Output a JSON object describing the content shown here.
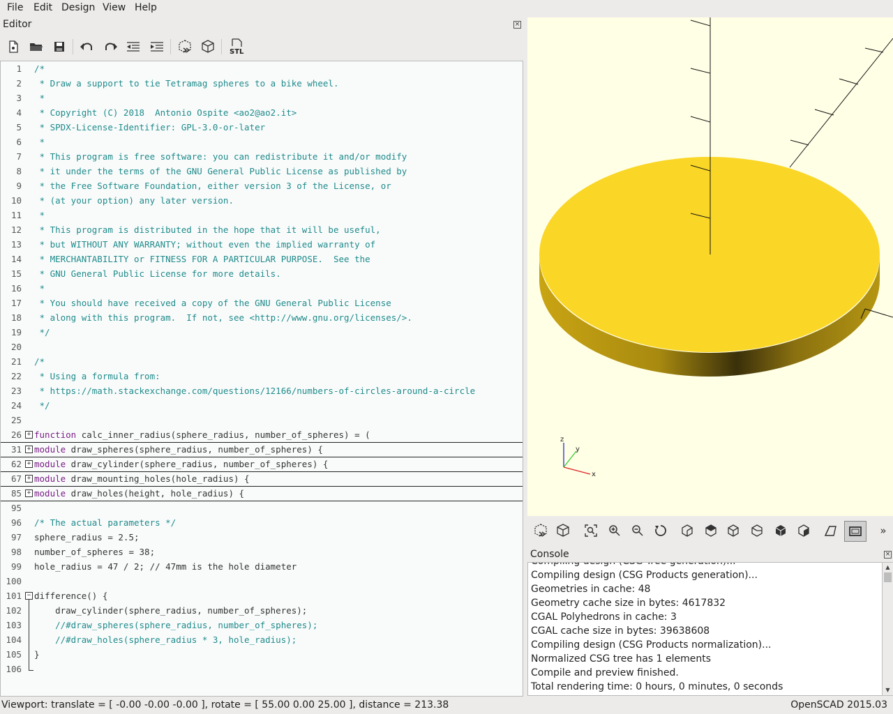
{
  "menu": [
    "File",
    "Edit",
    "Design",
    "View",
    "Help"
  ],
  "editor": {
    "title": "Editor",
    "toolbar": {
      "stl_label": "STL"
    },
    "lines": [
      {
        "n": "1",
        "t": "/*",
        "c": "comment"
      },
      {
        "n": "2",
        "t": " * Draw a support to tie Tetramag spheres to a bike wheel.",
        "c": "comment"
      },
      {
        "n": "3",
        "t": " *",
        "c": "comment"
      },
      {
        "n": "4",
        "t": " * Copyright (C) 2018  Antonio Ospite <ao2@ao2.it>",
        "c": "comment"
      },
      {
        "n": "5",
        "t": " * SPDX-License-Identifier: GPL-3.0-or-later",
        "c": "comment"
      },
      {
        "n": "6",
        "t": " *",
        "c": "comment"
      },
      {
        "n": "7",
        "t": " * This program is free software: you can redistribute it and/or modify",
        "c": "comment"
      },
      {
        "n": "8",
        "t": " * it under the terms of the GNU General Public License as published by",
        "c": "comment"
      },
      {
        "n": "9",
        "t": " * the Free Software Foundation, either version 3 of the License, or",
        "c": "comment"
      },
      {
        "n": "10",
        "t": " * (at your option) any later version.",
        "c": "comment"
      },
      {
        "n": "11",
        "t": " *",
        "c": "comment"
      },
      {
        "n": "12",
        "t": " * This program is distributed in the hope that it will be useful,",
        "c": "comment"
      },
      {
        "n": "13",
        "t": " * but WITHOUT ANY WARRANTY; without even the implied warranty of",
        "c": "comment"
      },
      {
        "n": "14",
        "t": " * MERCHANTABILITY or FITNESS FOR A PARTICULAR PURPOSE.  See the",
        "c": "comment"
      },
      {
        "n": "15",
        "t": " * GNU General Public License for more details.",
        "c": "comment"
      },
      {
        "n": "16",
        "t": " *",
        "c": "comment"
      },
      {
        "n": "17",
        "t": " * You should have received a copy of the GNU General Public License",
        "c": "comment"
      },
      {
        "n": "18",
        "t": " * along with this program.  If not, see <http://www.gnu.org/licenses/>.",
        "c": "comment"
      },
      {
        "n": "19",
        "t": " */",
        "c": "comment"
      },
      {
        "n": "20",
        "t": "",
        "c": ""
      },
      {
        "n": "21",
        "t": "/*",
        "c": "comment"
      },
      {
        "n": "22",
        "t": " * Using a formula from:",
        "c": "comment"
      },
      {
        "n": "23",
        "t": " * https://math.stackexchange.com/questions/12166/numbers-of-circles-around-a-circle",
        "c": "comment"
      },
      {
        "n": "24",
        "t": " */",
        "c": "comment"
      },
      {
        "n": "25",
        "t": "",
        "c": ""
      },
      {
        "n": "26",
        "kw": "function",
        "t": " calc_inner_radius(sphere_radius, number_of_spheres) = (",
        "c": "",
        "fold": "plus"
      },
      {
        "n": "31",
        "kw": "module",
        "t": " draw_spheres(sphere_radius, number_of_spheres) {",
        "c": "",
        "fold": "plus"
      },
      {
        "n": "62",
        "kw": "module",
        "t": " draw_cylinder(sphere_radius, number_of_spheres) {",
        "c": "",
        "fold": "plus"
      },
      {
        "n": "67",
        "kw": "module",
        "t": " draw_mounting_holes(hole_radius) {",
        "c": "",
        "fold": "plus"
      },
      {
        "n": "85",
        "kw": "module",
        "t": " draw_holes(height, hole_radius) {",
        "c": "",
        "fold": "plus"
      },
      {
        "n": "95",
        "t": "",
        "c": ""
      },
      {
        "n": "96",
        "t": "/* The actual parameters */",
        "c": "comment"
      },
      {
        "n": "97",
        "t": "sphere_radius = 2.5;",
        "c": ""
      },
      {
        "n": "98",
        "t": "number_of_spheres = 38;",
        "c": ""
      },
      {
        "n": "99",
        "t": "hole_radius = 47 / 2; // 47mm is the hole diameter",
        "c": ""
      },
      {
        "n": "100",
        "t": "",
        "c": ""
      },
      {
        "n": "101",
        "t": "difference() {",
        "c": "",
        "fold": "minus"
      },
      {
        "n": "102",
        "t": "    draw_cylinder(sphere_radius, number_of_spheres);",
        "c": ""
      },
      {
        "n": "103",
        "t": "    //#draw_spheres(sphere_radius, number_of_spheres);",
        "c": "comment"
      },
      {
        "n": "104",
        "t": "    //#draw_holes(sphere_radius * 3, hole_radius);",
        "c": "comment"
      },
      {
        "n": "105",
        "t": "}",
        "c": ""
      },
      {
        "n": "106",
        "t": "",
        "c": ""
      }
    ]
  },
  "console": {
    "title": "Console",
    "lines": [
      "Compiling design (CSG Tree generation)...",
      "Compiling design (CSG Products generation)...",
      "Geometries in cache: 48",
      "Geometry cache size in bytes: 4617832",
      "CGAL Polyhedrons in cache: 3",
      "CGAL cache size in bytes: 39638608",
      "Compiling design (CSG Products normalization)...",
      "Normalized CSG tree has 1 elements",
      "Compile and preview finished.",
      "Total rendering time: 0 hours, 0 minutes, 0 seconds"
    ]
  },
  "viewport": {
    "axis_labels": {
      "x": "x",
      "y": "y",
      "z": "z"
    },
    "model_color": "#fad626"
  },
  "status": {
    "left": "Viewport: translate = [ -0.00 -0.00 -0.00 ], rotate = [ 55.00 0.00 25.00 ], distance = 213.38",
    "right": "OpenSCAD 2015.03"
  }
}
